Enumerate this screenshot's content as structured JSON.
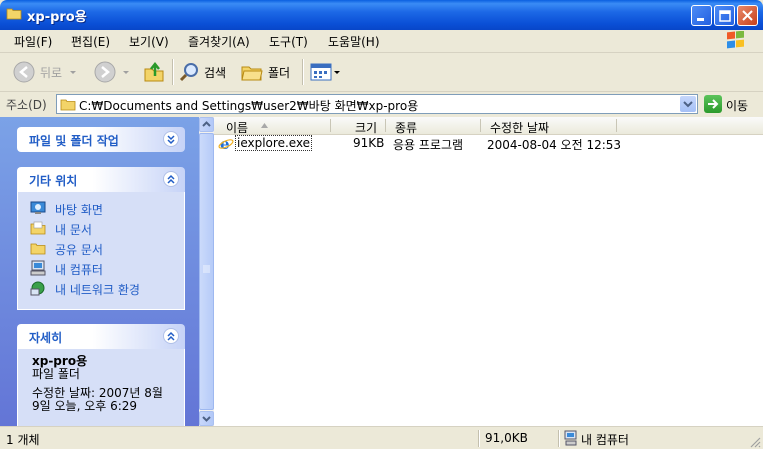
{
  "window": {
    "title": "xp-pro용"
  },
  "menu": [
    "파일(F)",
    "편집(E)",
    "보기(V)",
    "즐겨찾기(A)",
    "도구(T)",
    "도움말(H)"
  ],
  "toolbar": {
    "back_label": "뒤로",
    "search_label": "검색",
    "folders_label": "폴더"
  },
  "address": {
    "label": "주소(D)",
    "path": "C:₩Documents and Settings₩user2₩바탕 화면₩xp-pro용",
    "go_label": "이동"
  },
  "taskpane": {
    "file_tasks_title": "파일 및 폴더 작업",
    "other_places_title": "기타 위치",
    "other_places": [
      {
        "label": "바탕 화면",
        "icon": "desktop-icon"
      },
      {
        "label": "내 문서",
        "icon": "my-documents-icon"
      },
      {
        "label": "공유 문서",
        "icon": "shared-folder-icon"
      },
      {
        "label": "내 컴퓨터",
        "icon": "my-computer-icon"
      },
      {
        "label": "내 네트워크 환경",
        "icon": "network-places-icon"
      }
    ],
    "details_title": "자세히",
    "details": {
      "name": "xp-pro용",
      "type": "파일 폴더",
      "modified_line1": "수정한 날짜: 2007년 8월",
      "modified_line2": "9일 오늘, 오후 6:29"
    }
  },
  "columns": {
    "name": "이름",
    "size": "크기",
    "type": "종류",
    "modified": "수정한 날짜"
  },
  "files": [
    {
      "name": "iexplore.exe",
      "size": "91KB",
      "type": "응용 프로그램",
      "modified": "2004-08-04 오전 12:53",
      "icon": "internet-explorer-icon"
    }
  ],
  "status": {
    "count": "1 개체",
    "size": "91,0KB",
    "location": "내 컴퓨터"
  },
  "colors": {
    "titlebar": "#0a4fd6",
    "taskpane_link": "#215dc6",
    "taskpane_bg": "#7ba2e7"
  }
}
